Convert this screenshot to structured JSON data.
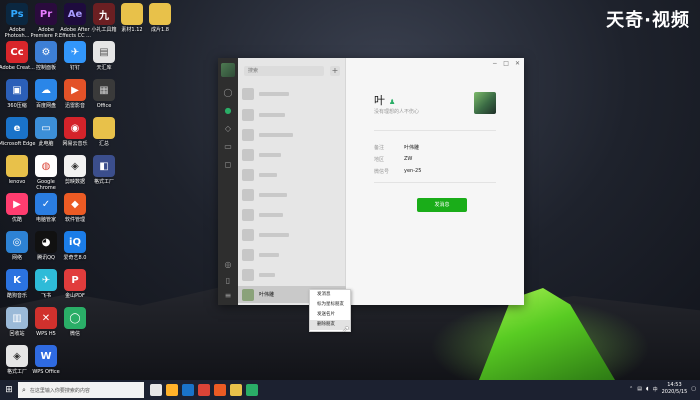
{
  "watermark": "天奇·视频",
  "desktop_icons": [
    {
      "label": "Adobe Photosh...",
      "glyph": "Ps",
      "color": "#0b2740",
      "fg": "#31a8ff"
    },
    {
      "label": "Adobe Premiere P...",
      "glyph": "Pr",
      "color": "#2a0b3d",
      "fg": "#e77cff"
    },
    {
      "label": "Adobe After Effects CC ...",
      "glyph": "Ae",
      "color": "#1e0b3d",
      "fg": "#a99cff"
    },
    {
      "label": "小礼工具箱",
      "glyph": "九",
      "color": "#6b1f22",
      "fg": "#ffffff"
    },
    {
      "label": "素材1.12",
      "glyph": "▮",
      "color": "#e8c14a",
      "fg": "#e8c14a"
    },
    {
      "label": "成片1.8",
      "glyph": "▮",
      "color": "#e8c14a",
      "fg": "#e8c14a"
    },
    {
      "label": "Adobe Creat...",
      "glyph": "Cc",
      "color": "#d8262b",
      "fg": "#ffffff"
    },
    {
      "label": "控制面板",
      "glyph": "⚙",
      "color": "#3d7fd6",
      "fg": "#ffffff"
    },
    {
      "label": "钉钉",
      "glyph": "✈",
      "color": "#3296fa",
      "fg": "#ffffff"
    },
    {
      "label": "天汇库",
      "glyph": "▤",
      "color": "#e6e6e6",
      "fg": "#555555"
    },
    {
      "label": "360压缩",
      "glyph": "▣",
      "color": "#2b5fb8",
      "fg": "#ffffff"
    },
    {
      "label": "百度网盘",
      "glyph": "☁",
      "color": "#2a86e8",
      "fg": "#ffffff"
    },
    {
      "label": "迅雷影音",
      "glyph": "▶",
      "color": "#e35228",
      "fg": "#ffffff"
    },
    {
      "label": "Office",
      "glyph": "▦",
      "color": "#3a3a3a",
      "fg": "#cccccc"
    },
    {
      "label": "Microsoft Edge",
      "glyph": "e",
      "color": "#1a73c9",
      "fg": "#ffffff"
    },
    {
      "label": "此电脑",
      "glyph": "▭",
      "color": "#3c8fd8",
      "fg": "#ffffff"
    },
    {
      "label": "网易云音乐",
      "glyph": "◉",
      "color": "#d4232a",
      "fg": "#ffffff"
    },
    {
      "label": "汇总",
      "glyph": "▮",
      "color": "#e8c14a",
      "fg": "#e8c14a"
    },
    {
      "label": "lenovo",
      "glyph": "▮",
      "color": "#e8c14a",
      "fg": "#e8c14a"
    },
    {
      "label": "Google Chrome",
      "glyph": "◍",
      "color": "#ffffff",
      "fg": "#db4437"
    },
    {
      "label": "剪映数据",
      "glyph": "◈",
      "color": "#f2f2f2",
      "fg": "#333333"
    },
    {
      "label": "格式工厂",
      "glyph": "◧",
      "color": "#3b4e8c",
      "fg": "#ffffff"
    },
    {
      "label": "优酷",
      "glyph": "▶",
      "color": "#ff3d6f",
      "fg": "#ffffff"
    },
    {
      "label": "电脑管家",
      "glyph": "✓",
      "color": "#2a7de1",
      "fg": "#ffffff"
    },
    {
      "label": "软件管理",
      "glyph": "◆",
      "color": "#ec5b24",
      "fg": "#ffffff"
    },
    {
      "label": "网络",
      "glyph": "◎",
      "color": "#2d82d4",
      "fg": "#ffffff"
    },
    {
      "label": "腾讯QQ",
      "glyph": "◕",
      "color": "#111111",
      "fg": "#ffffff"
    },
    {
      "label": "爱奇艺8.0",
      "glyph": "iQ",
      "color": "#1b7de8",
      "fg": "#ffffff"
    },
    {
      "label": "酷狗音乐",
      "glyph": "K",
      "color": "#2b73e0",
      "fg": "#ffffff"
    },
    {
      "label": "飞书",
      "glyph": "✈",
      "color": "#2ebbd8",
      "fg": "#ffffff"
    },
    {
      "label": "金山PDF",
      "glyph": "P",
      "color": "#e13c3c",
      "fg": "#ffffff"
    },
    {
      "label": "回收站",
      "glyph": "▥",
      "color": "#9bbad8",
      "fg": "#ffffff"
    },
    {
      "label": "WPS H5",
      "glyph": "✕",
      "color": "#d0312d",
      "fg": "#ffffff"
    },
    {
      "label": "微信",
      "glyph": "◯",
      "color": "#2aae67",
      "fg": "#ffffff"
    },
    {
      "label": "格式工厂",
      "glyph": "◈",
      "color": "#e6e6e6",
      "fg": "#333333"
    },
    {
      "label": "WPS Office",
      "glyph": "W",
      "color": "#2f6ae0",
      "fg": "#ffffff"
    }
  ],
  "wechat": {
    "search_placeholder": "搜索",
    "add_glyph": "+",
    "selected_contact": "叶伟雕",
    "window_controls": [
      "−",
      "□",
      "✕"
    ],
    "detail": {
      "name": "叶",
      "signature": "没有理想的人不伤心",
      "fields": [
        {
          "key": "备注",
          "value": "叶伟雕"
        },
        {
          "key": "地区",
          "value": "ZW"
        },
        {
          "key": "微信号",
          "value": "yen-25"
        }
      ],
      "send_button": "发消息"
    }
  },
  "context_menu": {
    "items": [
      "发消息",
      "标为星标朋友",
      "发送名片",
      "删除朋友"
    ],
    "hover_index": 3
  },
  "taskbar": {
    "search_placeholder": "在这里输入你要搜索的内容",
    "clock_time": "14:53",
    "clock_date": "2020/5/15"
  }
}
